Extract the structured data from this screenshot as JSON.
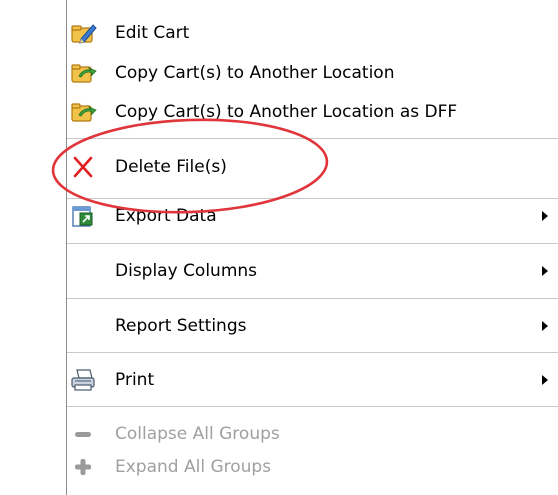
{
  "menu": {
    "items": [
      {
        "label": "Edit Cart",
        "icon": "edit-cart-icon"
      },
      {
        "label": "Copy Cart(s) to Another Location",
        "icon": "copy-cart-icon"
      },
      {
        "label": "Copy Cart(s) to Another Location as DFF",
        "icon": "copy-cart-dff-icon"
      },
      {
        "label": "Delete File(s)",
        "icon": "delete-x-icon"
      },
      {
        "label": "Export Data",
        "icon": "export-data-icon",
        "submenu": true
      },
      {
        "label": "Display Columns",
        "submenu": true
      },
      {
        "label": "Report Settings",
        "submenu": true
      },
      {
        "label": "Print",
        "icon": "printer-icon",
        "submenu": true
      },
      {
        "label": "Collapse All Groups",
        "icon": "minus-icon",
        "disabled": true
      },
      {
        "label": "Expand All Groups",
        "icon": "plus-icon",
        "disabled": true
      }
    ]
  },
  "colors": {
    "annotation_ellipse": "#e0353b",
    "delete_x": "#e02020",
    "disabled_text": "#a0a0a0",
    "separator": "#c8c8c8"
  }
}
